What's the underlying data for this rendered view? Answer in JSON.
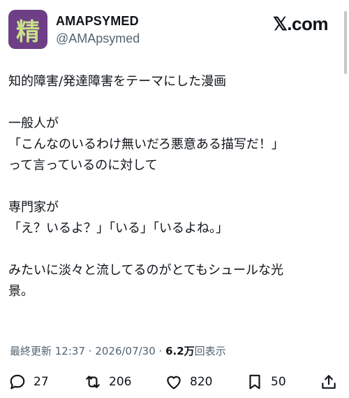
{
  "author": {
    "avatar_char": "精",
    "display_name": "AMAPSYMED",
    "handle": "@AMApsymed"
  },
  "site_logo": "𝕏.com",
  "post": {
    "paragraphs": [
      [
        "知的障害/発達障害をテーマにした漫画"
      ],
      [
        "一般人が",
        "「こんなのいるわけ無いだろ悪意ある描写だ！」",
        "って言っているのに対して"
      ],
      [
        "専門家が",
        "「え？いるよ？」「いる」「いるよね。」"
      ],
      [
        "みたいに淡々と流してるのがとてもシュールな光",
        "景。"
      ]
    ]
  },
  "meta": {
    "time": "最終更新 12:37",
    "sep1": " · ",
    "date": "2026/07/30",
    "sep2": " · ",
    "views_number": "6.2万",
    "views_label": "回表示"
  },
  "actions": {
    "replies": "27",
    "reposts": "206",
    "likes": "820",
    "bookmarks": "50"
  },
  "icons": [
    "reply-icon",
    "repost-icon",
    "like-icon",
    "bookmark-icon",
    "share-icon"
  ],
  "colors": {
    "text": "#0f1419",
    "secondary": "#536471",
    "avatar_bg": "#6e3f86",
    "avatar_fg": "#c8e28a"
  }
}
